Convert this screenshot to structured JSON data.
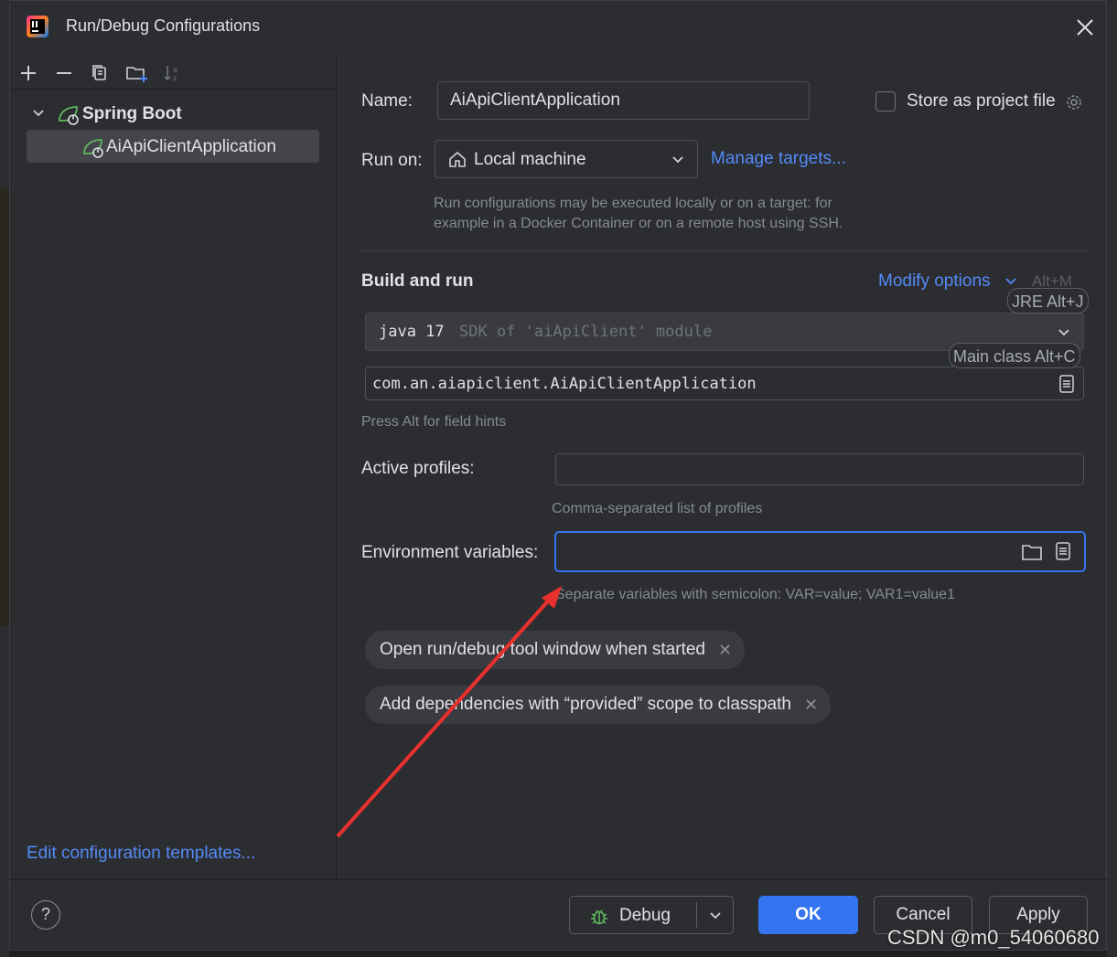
{
  "window": {
    "title": "Run/Debug Configurations"
  },
  "tree": {
    "group_label": "Spring Boot",
    "item_label": "AiApiClientApplication"
  },
  "left_footer": {
    "edit_templates": "Edit configuration templates..."
  },
  "form": {
    "name_label": "Name:",
    "name_value": "AiApiClientApplication",
    "store_label": "Store as project file",
    "run_on_label": "Run on:",
    "run_on_value": "Local machine",
    "manage_targets": "Manage targets...",
    "run_on_hint_1": "Run configurations may be executed locally or on a target: for",
    "run_on_hint_2": "example in a Docker Container or on a remote host using SSH.",
    "section_title": "Build and run",
    "modify_options": "Modify options",
    "modify_shortcut": "Alt+M",
    "jre_tip": "JRE Alt+J",
    "jdk_main": "java 17",
    "jdk_sub": "SDK of 'aiApiClient' module",
    "main_class_tip": "Main class Alt+C",
    "main_class_value": "com.an.aiapiclient.AiApiClientApplication",
    "field_hints": "Press Alt for field hints",
    "active_profiles_label": "Active profiles:",
    "active_profiles_value": "",
    "active_profiles_hint": "Comma-separated list of profiles",
    "env_label": "Environment variables:",
    "env_value": "",
    "env_hint": "Separate variables with semicolon: VAR=value; VAR1=value1"
  },
  "chips": [
    "Open run/debug tool window when started",
    "Add dependencies with “provided” scope to classpath"
  ],
  "buttons": {
    "debug": "Debug",
    "ok": "OK",
    "cancel": "Cancel",
    "apply": "Apply"
  },
  "watermark": "CSDN @m0_54060680",
  "colors": {
    "accent": "#3574f0",
    "link": "#548af7",
    "spring_green": "#5fb85f",
    "annotation_arrow": "#e8302f"
  },
  "icons": [
    "app-icon",
    "close-icon",
    "add-icon",
    "remove-icon",
    "copy-icon",
    "new-folder-icon",
    "sort-icon",
    "chevron-down-icon",
    "spring-boot-icon",
    "home-icon",
    "gear-icon",
    "expand-icon",
    "folder-icon",
    "bug-icon",
    "help-icon"
  ]
}
